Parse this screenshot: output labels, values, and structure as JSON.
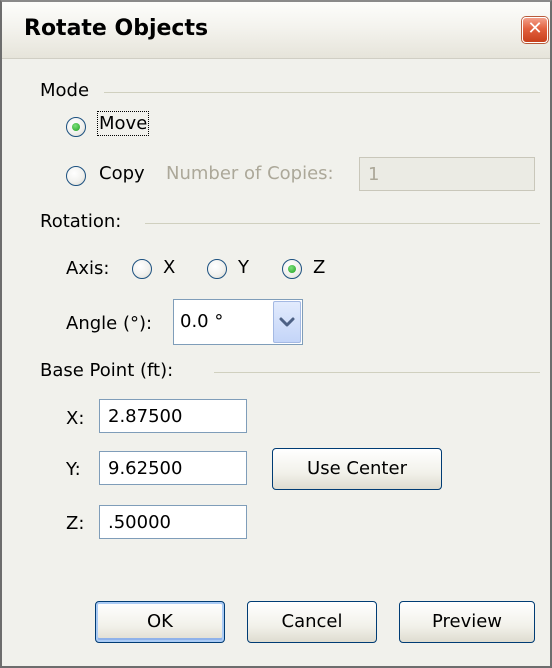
{
  "window": {
    "title": "Rotate Objects",
    "close_symbol": "✕"
  },
  "mode": {
    "label": "Mode",
    "options": {
      "move": "Move",
      "copy": "Copy"
    },
    "selected": "Move",
    "copies_label": "Number of Copies:",
    "copies_value": "1"
  },
  "rotation": {
    "label": "Rotation:",
    "axis_label": "Axis:",
    "axes": [
      "X",
      "Y",
      "Z"
    ],
    "selected_axis": "Z",
    "angle_label": "Angle (°):",
    "angle_value": "0.0 °"
  },
  "base_point": {
    "label": "Base Point (ft):",
    "x_label": "X:",
    "x_value": "2.87500",
    "y_label": "Y:",
    "y_value": "9.62500",
    "z_label": "Z:",
    "z_value": ".50000",
    "use_center_label": "Use Center"
  },
  "buttons": {
    "ok": "OK",
    "cancel": "Cancel",
    "preview": "Preview"
  }
}
